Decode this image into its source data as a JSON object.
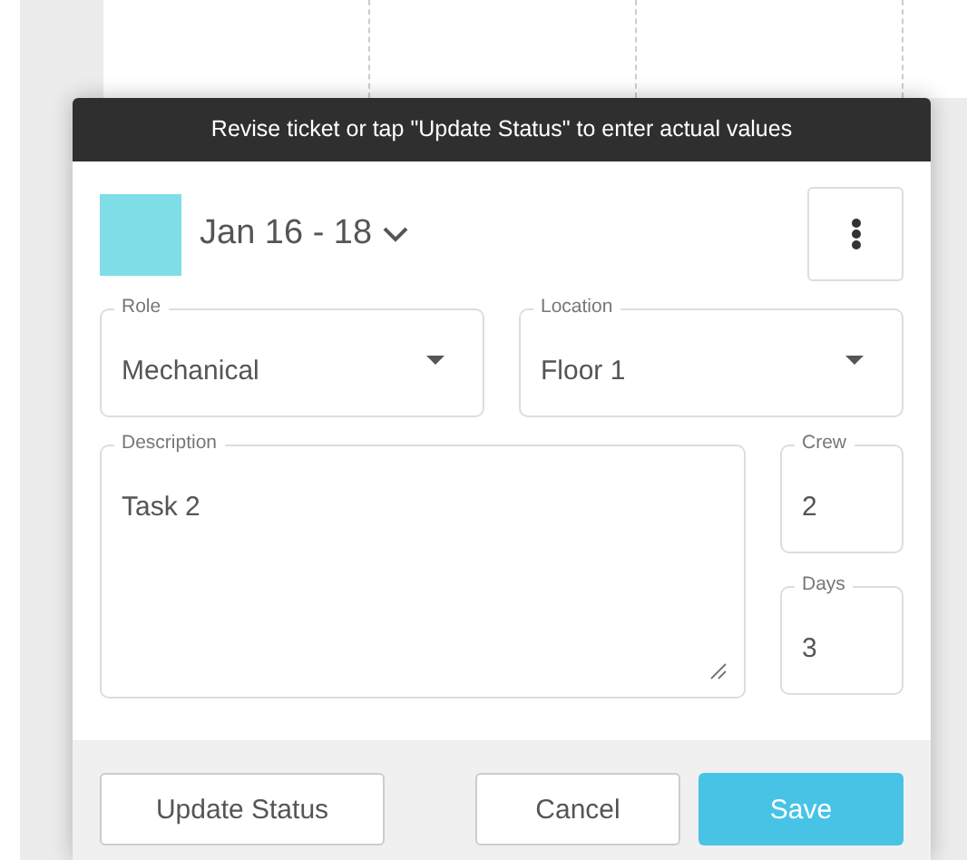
{
  "banner": "Revise ticket or tap \"Update Status\" to enter actual values",
  "ticket": {
    "color": "#7fdde8",
    "dates": "Jan 16 - 18"
  },
  "selects": [
    {
      "label": "Role",
      "value": "Mechanical"
    },
    {
      "label": "Location",
      "value": "Floor 1"
    }
  ],
  "description": {
    "label": "Description",
    "value": "Task 2"
  },
  "numbers": [
    {
      "label": "Crew",
      "value": "2"
    },
    {
      "label": "Days",
      "value": "3"
    }
  ],
  "buttons": [
    {
      "label": "Update Status",
      "kind": "secondary"
    },
    {
      "label": "Cancel",
      "kind": "secondary"
    },
    {
      "label": "Save",
      "kind": "primary"
    }
  ]
}
